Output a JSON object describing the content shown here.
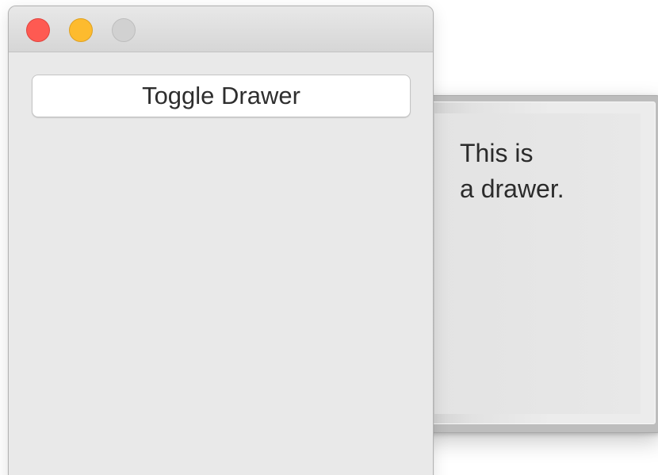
{
  "window": {
    "controls": {
      "close": "close-button",
      "minimize": "minimize-button",
      "zoom": "zoom-button"
    },
    "toggle_button_label": "Toggle Drawer"
  },
  "drawer": {
    "text": "This is\na drawer."
  },
  "colors": {
    "close": "#fe5a52",
    "minimize": "#fdbb2e",
    "zoom_disabled": "#d1d1d1",
    "window_bg": "#e9e9e9"
  }
}
